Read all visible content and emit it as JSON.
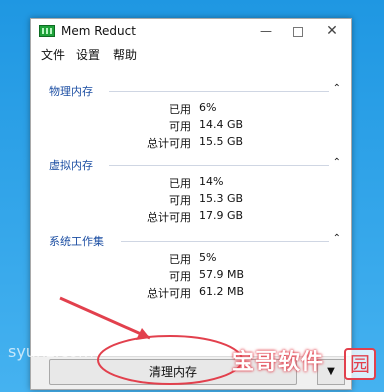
{
  "window": {
    "title": "Mem Reduct"
  },
  "menu": [
    "文件",
    "设置",
    "帮助"
  ],
  "groups": [
    {
      "title": "物理内存",
      "rows": [
        {
          "label": "已用",
          "value": "6%"
        },
        {
          "label": "可用",
          "value": "14.4 GB"
        },
        {
          "label": "总计可用",
          "value": "15.5 GB"
        }
      ]
    },
    {
      "title": "虚拟内存",
      "rows": [
        {
          "label": "已用",
          "value": "14%"
        },
        {
          "label": "可用",
          "value": "15.3 GB"
        },
        {
          "label": "总计可用",
          "value": "17.9 GB"
        }
      ]
    },
    {
      "title": "系统工作集",
      "rows": [
        {
          "label": "已用",
          "value": "5%"
        },
        {
          "label": "可用",
          "value": "57.9 MB"
        },
        {
          "label": "总计可用",
          "value": "61.2 MB"
        }
      ]
    }
  ],
  "actions": {
    "clean_label": "清理内存",
    "dropdown_glyph": "▼"
  },
  "titlebar": {
    "minimize_glyph": "—",
    "close_glyph": "✕"
  },
  "caret_glyph": "⌃",
  "watermarks": {
    "left_text": "syunz.com",
    "logo_text": "宝哥软件",
    "logo_box": "园"
  },
  "colors": {
    "group_title": "#1d4fa3",
    "desktop": "#2aa0e6",
    "annotation": "#e2404d"
  }
}
